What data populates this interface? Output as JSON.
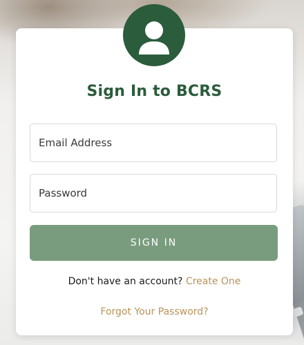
{
  "signin": {
    "title": "Sign In to BCRS",
    "email_placeholder": "Email Address",
    "password_placeholder": "Password",
    "submit_label": "SIGN IN",
    "no_account_text": "Don't have an account?",
    "create_link": "Create One",
    "forgot_link": "Forgot Your Password?"
  },
  "icons": {
    "avatar": "user-icon"
  },
  "colors": {
    "brand_green": "#2b5c3c",
    "button_green": "#799c7e",
    "link_gold": "#b8935a",
    "card_bg": "#ffffff"
  }
}
